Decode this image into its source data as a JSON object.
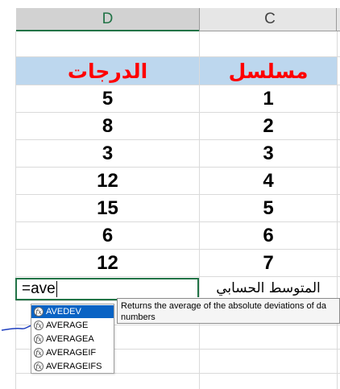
{
  "columns": {
    "d": "D",
    "c": "C"
  },
  "table_header": {
    "grades": "الدرجات",
    "serial": "مسلسل"
  },
  "rows": [
    {
      "grade": "5",
      "serial": "1"
    },
    {
      "grade": "8",
      "serial": "2"
    },
    {
      "grade": "3",
      "serial": "3"
    },
    {
      "grade": "12",
      "serial": "4"
    },
    {
      "grade": "15",
      "serial": "5"
    },
    {
      "grade": "6",
      "serial": "6"
    },
    {
      "grade": "12",
      "serial": "7"
    }
  ],
  "active_cell": {
    "value": "=ave"
  },
  "mean_label": "المتوسط الحسابي",
  "autocomplete": {
    "items": [
      "AVEDEV",
      "AVERAGE",
      "AVERAGEA",
      "AVERAGEIF",
      "AVERAGEIFS"
    ],
    "selected_index": 0
  },
  "tooltip": {
    "line1": "Returns the average of the absolute deviations of da",
    "line2": "numbers"
  },
  "colors": {
    "header_fill": "#bdd7ee",
    "header_text": "#ff0000",
    "active_border": "#217346",
    "selection": "#0a63c4"
  }
}
